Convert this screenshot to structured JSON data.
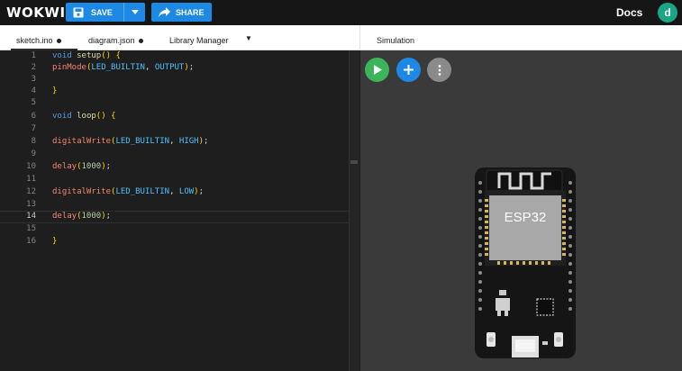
{
  "app": {
    "logo": "WOKWI",
    "save_label": "SAVE",
    "share_label": "SHARE",
    "docs_label": "Docs",
    "avatar_letter": "d"
  },
  "tabs": [
    {
      "label": "sketch.ino",
      "active": true
    },
    {
      "label": "diagram.json",
      "active": false
    },
    {
      "label": "Library Manager",
      "active": false
    }
  ],
  "simulation": {
    "title": "Simulation",
    "board_label": "ESP32"
  },
  "editor": {
    "current_line": 14,
    "line_numbers": [
      "1",
      "2",
      "3",
      "4",
      "5",
      "6",
      "7",
      "8",
      "9",
      "10",
      "11",
      "12",
      "13",
      "14",
      "15",
      "16"
    ]
  },
  "colors": {
    "accent": "#1e88e5",
    "play": "#3cb45a",
    "add": "#1e88e5",
    "more": "#8a8a8a",
    "avatar": "#1aa586"
  }
}
